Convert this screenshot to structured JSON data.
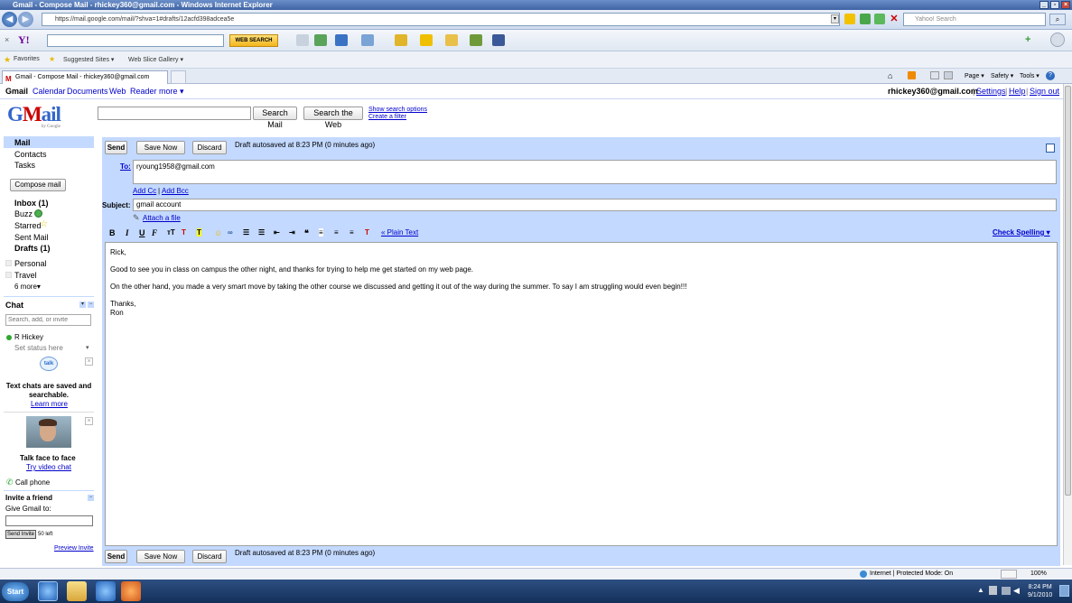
{
  "window": {
    "title": "Gmail - Compose Mail - rhickey360@gmail.com - Windows Internet Explorer",
    "url": "https://mail.google.com/mail/?shva=1#drafts/12acfd398adcea5e",
    "search_placeholder": "Yahoo! Search"
  },
  "yahoo_toolbar": {
    "web_search_label": "WEB SEARCH"
  },
  "favorites_bar": {
    "favorites": "Favorites",
    "suggested": "Suggested Sites ▾",
    "gallery": "Web Slice Gallery ▾"
  },
  "tab": {
    "label": "Gmail - Compose Mail - rhickey360@gmail.com"
  },
  "command_bar": {
    "page": "Page ▾",
    "safety": "Safety ▾",
    "tools": "Tools ▾"
  },
  "gbar": {
    "items": [
      "Gmail",
      "Calendar",
      "Documents",
      "Web",
      "Reader",
      "more ▾"
    ],
    "account": "rhickey360@gmail.com",
    "settings": "Settings",
    "help": "Help",
    "signout": "Sign out"
  },
  "search": {
    "search_mail": "Search Mail",
    "search_web": "Search the Web",
    "show_options": "Show search options",
    "create_filter": "Create a filter"
  },
  "sidebar": {
    "mail": "Mail",
    "contacts": "Contacts",
    "tasks": "Tasks",
    "compose": "Compose mail",
    "inbox": "Inbox (1)",
    "buzz": "Buzz",
    "starred": "Starred",
    "sent": "Sent Mail",
    "drafts": "Drafts (1)",
    "label_personal": "Personal",
    "label_travel": "Travel",
    "more": "6 more▾"
  },
  "chat": {
    "title": "Chat",
    "search_placeholder": "Search, add, or invite",
    "user": "R Hickey",
    "status": "Set status here",
    "talk_text": "Text chats are saved and searchable.",
    "learn_more": "Learn more",
    "video_title": "Talk face to face",
    "video_link": "Try video chat",
    "call_phone": "Call phone"
  },
  "invite": {
    "title": "Invite a friend",
    "give": "Give Gmail to:",
    "send": "Send Invite",
    "left": "50 left",
    "preview": "Preview Invite"
  },
  "compose": {
    "send": "Send",
    "save_now": "Save Now",
    "discard": "Discard",
    "draft_status": "Draft autosaved at 8:23 PM (0 minutes ago)",
    "to_label": "To:",
    "to_value": "ryoung1958@gmail.com",
    "add_cc": "Add Cc",
    "add_bcc": "Add Bcc",
    "subject_label": "Subject:",
    "subject_value": "gmail account",
    "attach": "Attach a file",
    "plain_text": "« Plain Text",
    "check_spelling": "Check Spelling ▾",
    "body": [
      "Rick,",
      "Good to see you in class on campus the other night, and thanks for trying to help me get started on my web page.",
      "On the other hand, you made a very smart move by taking the other course we discussed and getting it out of the way during the summer.  To say I am struggling would even begin!!!",
      "Thanks,",
      "Ron"
    ]
  },
  "statusbar": {
    "zone": "Internet | Protected Mode: On",
    "zoom": "100%"
  },
  "taskbar": {
    "start": "Start",
    "time": "8:24 PM",
    "date": "9/1/2010"
  }
}
